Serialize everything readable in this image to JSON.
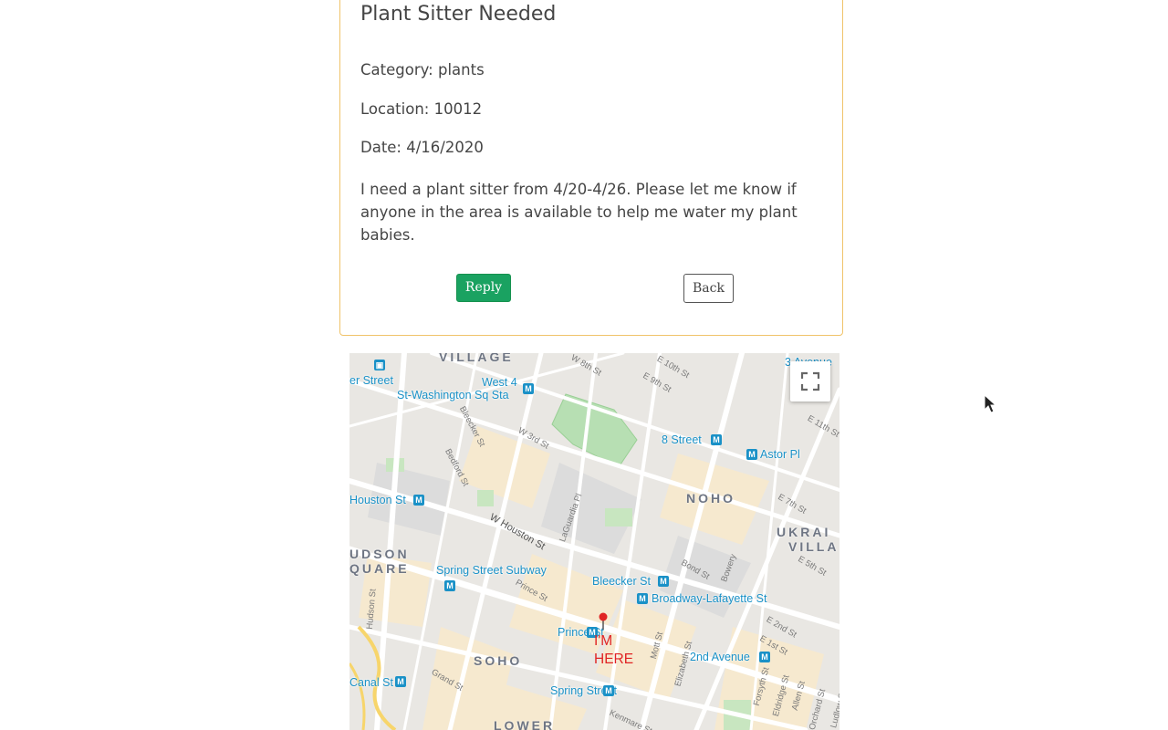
{
  "post": {
    "title": "Plant Sitter Needed",
    "category": "Category: plants",
    "location": "Location: 10012",
    "date": "Date: 4/16/2020",
    "description": "I need a plant sitter from 4/20-4/26. Please let me know if anyone in the area is available to help me water my plant babies.",
    "reply_label": "Reply",
    "back_label": "Back"
  },
  "map": {
    "marker_label": "I'M HERE",
    "fullscreen_icon": "fullscreen-icon",
    "stations": [
      "er Street",
      "West 4",
      "St-Washington Sq Sta",
      "8 Street",
      "Astor Pl",
      "Houston St",
      "Spring Street Subway",
      "Bleecker St",
      "Broadway-Lafayette St",
      "Prince St",
      "2nd Avenue",
      "Canal St",
      "Spring Street",
      "3 Avenue"
    ],
    "districts": [
      "VILLAGE",
      "NOHO",
      "UKRAI",
      "VILLA",
      "UDSON",
      "QUARE",
      "SOHO",
      "LOWER"
    ],
    "streets": [
      "W 8th St",
      "E 9th St",
      "E 10th St",
      "E 11th St",
      "Bleecker St",
      "W 3rd St",
      "Bedford St",
      "LaGuardia Pl",
      "W Houston St",
      "E 7th St",
      "E 5th St",
      "Bond St",
      "Bowery",
      "Prince St",
      "E 2nd St",
      "E 1st St",
      "Hudson St",
      "Mott St",
      "Elizabeth St",
      "Forsyth St",
      "Eldridge St",
      "Allen St",
      "Orchard St",
      "Ludlow St",
      "Grand St",
      "Kenmare St"
    ]
  },
  "colors": {
    "reply_bg": "#1aa261",
    "card_border": "#f0c36a",
    "marker": "#e02424",
    "station": "#1a91c7"
  }
}
